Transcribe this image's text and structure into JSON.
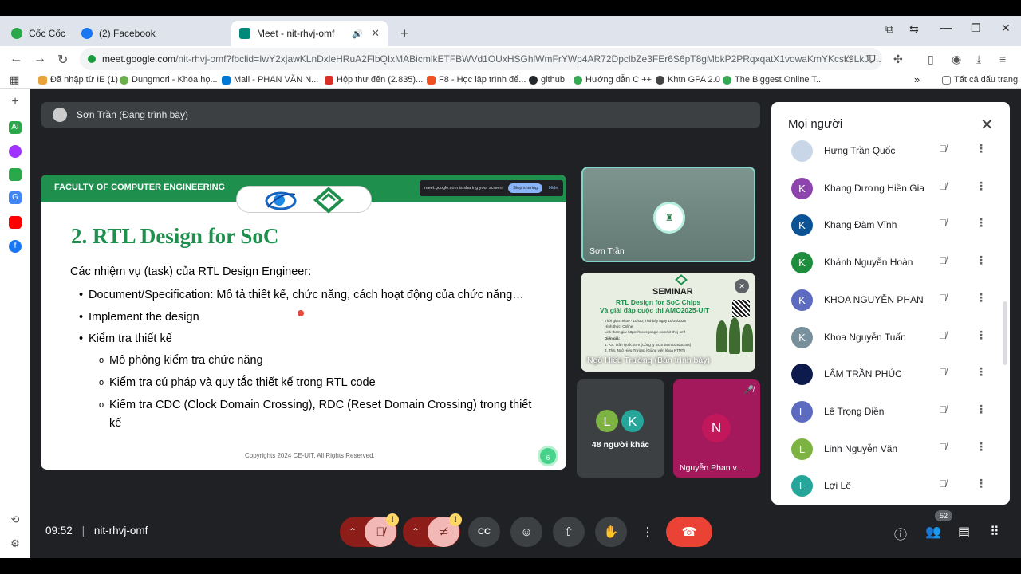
{
  "browser": {
    "tabs": [
      {
        "label": "Cốc Cốc",
        "color": "#2aa84a"
      },
      {
        "label": "(2) Facebook",
        "color": "#1877f2"
      },
      {
        "label": "Meet - nit-rhvj-omf",
        "color": "#00897b"
      }
    ],
    "new_tab": "+",
    "url_host": "meet.google.com",
    "url_path": "/nit-rhvj-omf?fbclid=IwY2xjawKLnDxleHRuA2FlbQIxMABicmlkETFBWVd1OUxHSGhlWmFrYWp4AR72DpclbZe3FEr6S6pT8gMbkP2PRqxqatX1vowaKmYKcsk9LkJU...",
    "bookmarks": [
      {
        "label": "Đã nhập từ IE (1)",
        "color": "#e8a33d"
      },
      {
        "label": "Dungmori - Khóa họ...",
        "color": "#6ab04c"
      },
      {
        "label": "Mail - PHAN VĂN N...",
        "color": "#0078d4"
      },
      {
        "label": "Hộp thư đến (2.835)...",
        "color": "#d93025"
      },
      {
        "label": "F8 - Học lập trình để...",
        "color": "#f05123"
      },
      {
        "label": "github",
        "color": "#24292e"
      },
      {
        "label": "Hướng dẫn C ++",
        "color": "#34a853"
      },
      {
        "label": "Khtn GPA 2.0",
        "color": "#444444"
      },
      {
        "label": "The Biggest Online T...",
        "color": "#34a853"
      }
    ],
    "bookmarks_more": "»",
    "all_bookmarks": "Tất cả dấu trang"
  },
  "meet": {
    "presenter_banner": "Sơn Trần (Đang trình bày)",
    "slide": {
      "faculty": "FACULTY OF COMPUTER ENGINEERING",
      "share_notice": "meet.google.com is sharing your screen.",
      "share_stop": "Stop sharing",
      "share_hide": "Hide",
      "title": "2. RTL Design for SoC",
      "intro": "Các nhiệm vụ (task) của RTL Design Engineer:",
      "bullets": [
        "Document/Specification: Mô tả thiết kế, chức năng, cách hoạt động của chức năng…",
        "Implement the design",
        "Kiểm tra thiết kế"
      ],
      "sub_bullets": [
        "Mô phỏng kiểm tra chức năng",
        "Kiểm tra cú pháp và quy tắc thiết kế trong RTL code",
        "Kiểm tra CDC (Clock Domain Crossing), RDC (Reset Domain Crossing) trong thiết kế"
      ],
      "footer": "Copyrights 2024 CE-UIT. All Rights Reserved.",
      "page_number": "6"
    },
    "tiles": {
      "son_name": "Sơn Trần",
      "seminar_line1": "SEMINAR",
      "seminar_line2": "RTL Design for SoC Chips",
      "seminar_line3": "Và giải đáp cuộc thi AMO2025-UIT",
      "seminar_time": "Thời gian: 9h30 - 10h30, Thứ bảy ngày 10/05/2025",
      "seminar_form": "Hình thức: Online",
      "seminar_link": "Link tham gia: https://meet.google.com/nit-rhvj-omf",
      "seminar_speakers": "Diễn giả:",
      "seminar_speaker1": "1. KS. Trần Quốc Sơn (Công ty BOS Semiconductors)",
      "seminar_speaker2": "2. ThS. Ngô Hiếu Trường (Giảng viên khoa KTMT)",
      "seminar_presenter": "Ngô Hiếu Trường (Bản trình bày)",
      "others_initials": [
        "L",
        "K"
      ],
      "others_count": "48 người khác",
      "nguyen_initial": "N",
      "nguyen_name": "Nguyễn Phan v..."
    },
    "people_panel": {
      "title": "Mọi người",
      "people": [
        {
          "name": "Hưng Trần Quốc",
          "initial": "",
          "color": "#c9d6e8"
        },
        {
          "name": "Khang Dương Hiền Gia",
          "initial": "K",
          "color": "#8e44ad"
        },
        {
          "name": "Khang Đàm Vĩnh",
          "initial": "K",
          "color": "#0b5394"
        },
        {
          "name": "Khánh Nguyễn Hoàn",
          "initial": "K",
          "color": "#1e8e3e"
        },
        {
          "name": "KHOA NGUYỄN PHAN",
          "initial": "K",
          "color": "#5c6bc0"
        },
        {
          "name": "Khoa Nguyễn Tuấn",
          "initial": "K",
          "color": "#78909c"
        },
        {
          "name": "LÂM TRẦN PHÚC",
          "initial": "",
          "color": "#0d1b4c"
        },
        {
          "name": "Lê Trọng Điền",
          "initial": "L",
          "color": "#5c6bc0"
        },
        {
          "name": "Linh Nguyễn Văn",
          "initial": "L",
          "color": "#7cb342"
        },
        {
          "name": "Lợi Lê",
          "initial": "L",
          "color": "#26a69a"
        }
      ]
    },
    "bottom": {
      "time": "09:52",
      "separator": "|",
      "meeting_code": "nit-rhvj-omf",
      "participant_count": "52"
    }
  }
}
